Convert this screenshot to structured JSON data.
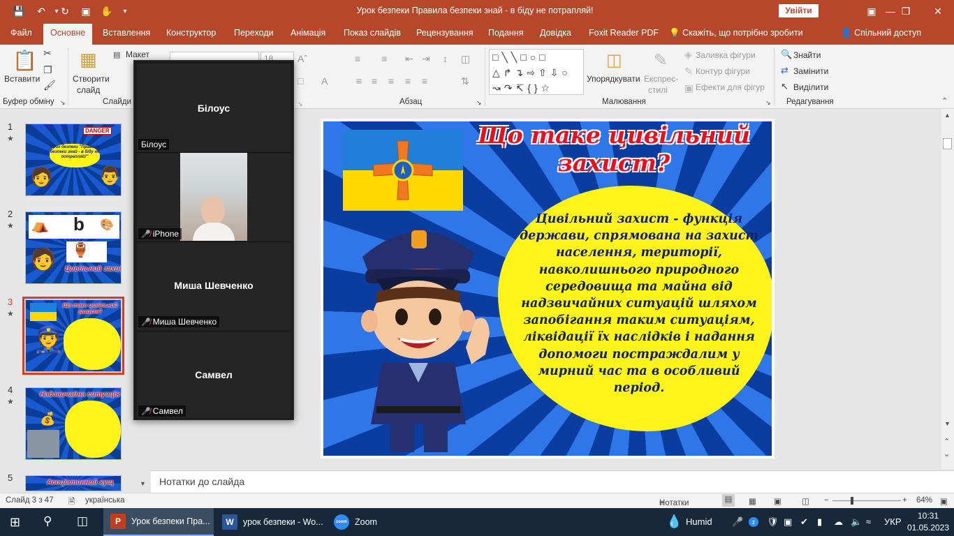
{
  "window": {
    "title": "Урок безпеки Правила безпеки знай - в біду не потрапляй!",
    "signin_label": "Увійти",
    "share_label": "Спільний доступ"
  },
  "menu": {
    "tabs": [
      "Файл",
      "Основне",
      "Вставлення",
      "Конструктор",
      "Переходи",
      "Анімація",
      "Показ слайдів",
      "Рецензування",
      "Подання",
      "Довідка",
      "Foxit Reader PDF"
    ],
    "active_tab": "Основне",
    "tell_me": "Скажіть, що потрібно зробити"
  },
  "ribbon": {
    "paste": "Вставити",
    "new_slide_line1": "Створити",
    "new_slide_line2": "слайд",
    "layout": "Макет",
    "arrange": "Упорядкувати",
    "quick_styles_line1": "Експрес-",
    "quick_styles_line2": "стилі",
    "shape_fill": "Заливка фігури",
    "shape_outline": "Контур фігури",
    "shape_effects": "Ефекти для фігур",
    "find": "Знайти",
    "replace": "Замінити",
    "select": "Виділити",
    "font_size": "18",
    "groups": {
      "clipboard": "Буфер обміну",
      "slides": "Слайди",
      "paragraph": "Абзац",
      "drawing": "Малювання",
      "editing": "Редагування"
    }
  },
  "thumbnails": [
    {
      "number": "1",
      "text": "Урок безпеки \"Правила безпеки знай - в біду не потрапляй!\"",
      "badge": "DANGER"
    },
    {
      "number": "2",
      "text": "Цивільний захист"
    },
    {
      "number": "3",
      "text": "Що таке цивільний захист?",
      "selected": true
    },
    {
      "number": "4",
      "text": "Надзвичайна ситуація"
    },
    {
      "number": "5",
      "text": "Асоціативний кущ"
    }
  ],
  "slide": {
    "title": "Що таке цивільний захист?",
    "body": "Цивільний захист - функція держави, спрямована на захист населення, території, навколишнього природного середовища та майна від надзвичайних ситуацій шляхом запобігання таким ситуаціям, ліквідації їх наслідків  і  надання допомоги  постраждалим у мирний час та в особливий період."
  },
  "notes_placeholder": "Нотатки до слайда",
  "zoom_participants": [
    {
      "name": "Білоус",
      "label": "Білоус",
      "muted": false,
      "video": false
    },
    {
      "name": "iPhone",
      "label": "iPhone",
      "muted": true,
      "video": true
    },
    {
      "name": "Миша Шевченко",
      "label": "Миша Шевченко",
      "muted": true,
      "video": false
    },
    {
      "name": "Самвел",
      "label": "Самвел",
      "muted": true,
      "video": false
    }
  ],
  "status": {
    "slide_counter": "Слайд 3 з 47",
    "language": "українська",
    "notes_button": "Нотатки",
    "zoom_level": "64%"
  },
  "taskbar": {
    "apps": [
      {
        "label": "Урок безпеки Пра...",
        "icon": "powerpoint-icon",
        "color": "#c43e1c",
        "letter": "P"
      },
      {
        "label": "урок безпеки - Wo...",
        "icon": "word-icon",
        "color": "#2b579a",
        "letter": "W"
      },
      {
        "label": "Zoom",
        "icon": "zoom-icon",
        "color": "#2d8cff",
        "letter": "zoom"
      }
    ],
    "weather": "Humid",
    "lang": "УКР",
    "time": "10:31",
    "date": "01.05.2023"
  }
}
